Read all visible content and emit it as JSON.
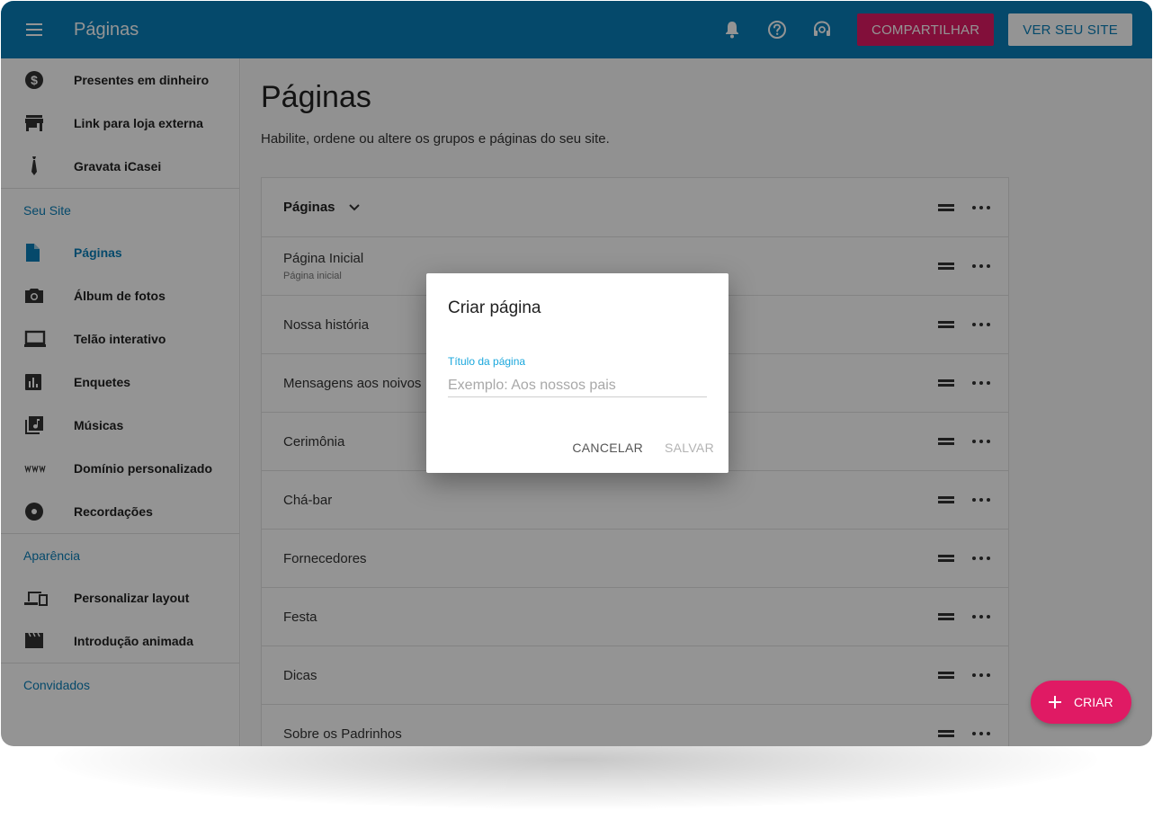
{
  "appbar": {
    "title": "Páginas",
    "share_label": "COMPARTILHAR",
    "view_site_label": "VER SEU SITE",
    "icons": [
      "menu-icon",
      "bell-icon",
      "help-icon",
      "support-icon"
    ]
  },
  "sidebar": {
    "items_top": [
      {
        "label": "Presentes em dinheiro",
        "icon": "dollar-icon"
      },
      {
        "label": "Link para loja externa",
        "icon": "store-icon"
      },
      {
        "label": "Gravata iCasei",
        "icon": "tie-icon"
      }
    ],
    "section_site": "Seu Site",
    "items_site": [
      {
        "label": "Páginas",
        "icon": "file-icon"
      },
      {
        "label": "Álbum de fotos",
        "icon": "camera-icon"
      },
      {
        "label": "Telão interativo",
        "icon": "screen-icon"
      },
      {
        "label": "Enquetes",
        "icon": "poll-icon"
      },
      {
        "label": "Músicas",
        "icon": "music-library-icon"
      },
      {
        "label": "Domínio personalizado",
        "icon": "www-icon"
      },
      {
        "label": "Recordações",
        "icon": "disc-icon"
      }
    ],
    "section_appearance": "Aparência",
    "items_appearance": [
      {
        "label": "Personalizar layout",
        "icon": "devices-icon"
      },
      {
        "label": "Introdução animada",
        "icon": "clapper-icon"
      }
    ],
    "section_guests": "Convidados"
  },
  "main": {
    "title": "Páginas",
    "subtitle": "Habilite, ordene ou altere os grupos e páginas do seu site.",
    "group_label": "Páginas",
    "rows": [
      {
        "title": "Página Inicial",
        "sub": "Página inicial"
      },
      {
        "title": "Nossa história"
      },
      {
        "title": "Mensagens aos noivos"
      },
      {
        "title": "Cerimônia"
      },
      {
        "title": "Chá-bar"
      },
      {
        "title": "Fornecedores"
      },
      {
        "title": "Festa"
      },
      {
        "title": "Dicas"
      },
      {
        "title": "Sobre os Padrinhos"
      }
    ],
    "fab_label": "CRIAR"
  },
  "dialog": {
    "title": "Criar página",
    "field_label": "Título da página",
    "field_placeholder": "Exemplo: Aos nossos pais",
    "field_value": "",
    "cancel_label": "CANCELAR",
    "save_label": "SALVAR"
  },
  "colors": {
    "primary": "#0a7fb8",
    "accent": "#e01a64",
    "field_focus": "#1aa7dc"
  }
}
